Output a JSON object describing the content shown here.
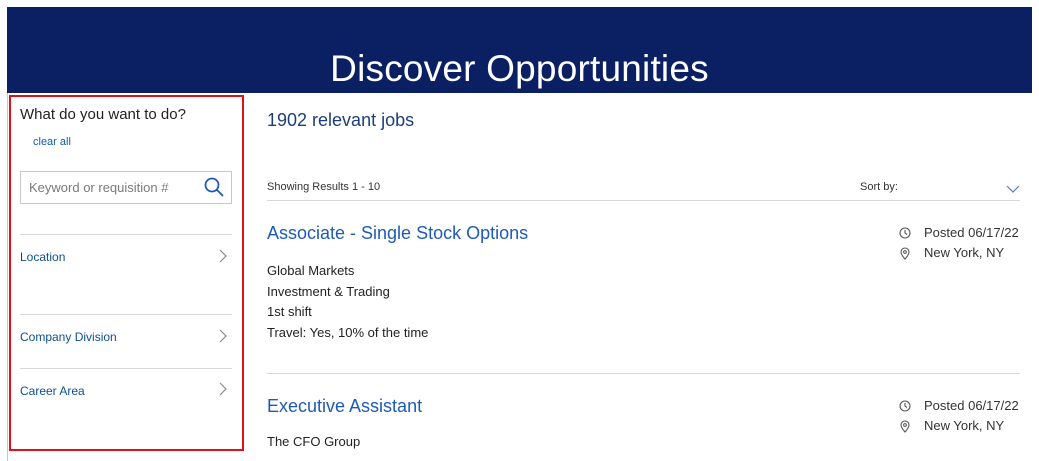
{
  "hero": {
    "title": "Discover Opportunities"
  },
  "filters": {
    "title": "What do you want to do?",
    "clear_all": "clear all",
    "search_placeholder": "Keyword or requisition #",
    "items": [
      {
        "label": "Location"
      },
      {
        "label": "Company Division"
      },
      {
        "label": "Career Area"
      }
    ]
  },
  "results": {
    "count_text": "1902 relevant jobs",
    "showing_text": "Showing Results 1 - 10",
    "sort_label": "Sort by:",
    "sort_value": ""
  },
  "jobs": [
    {
      "title": "Associate - Single Stock Options",
      "details": [
        "Global Markets",
        "Investment & Trading",
        "1st shift",
        "Travel: Yes, 10% of the time"
      ],
      "posted": "Posted 06/17/22",
      "location": "New York, NY"
    },
    {
      "title": "Executive Assistant",
      "details": [
        "The CFO Group"
      ],
      "posted": "Posted 06/17/22",
      "location": "New York, NY"
    }
  ],
  "icons": {
    "search": "search-icon",
    "chevron_right": "chevron-right-icon",
    "chevron_down": "chevron-down-icon",
    "clock": "clock-icon",
    "location_pin": "location-pin-icon"
  },
  "colors": {
    "hero_background": "#0b2063",
    "highlight_border": "#e0101b",
    "link_blue": "#1e5bb8",
    "filter_label_blue": "#0d4f96"
  }
}
